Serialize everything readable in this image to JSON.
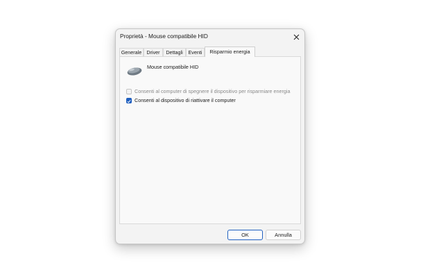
{
  "window": {
    "title": "Proprietà - Mouse compatibile HID",
    "close_icon": "close-icon"
  },
  "tabs": [
    {
      "label": "Generale",
      "active": false
    },
    {
      "label": "Driver",
      "active": false
    },
    {
      "label": "Dettagli",
      "active": false
    },
    {
      "label": "Eventi",
      "active": false
    },
    {
      "label": "Risparmio energia",
      "active": true
    }
  ],
  "device": {
    "name": "Mouse compatibile HID",
    "icon": "mouse-icon"
  },
  "options": [
    {
      "label": "Consenti al computer di spegnere il dispositivo per risparmiare energia",
      "checked": false,
      "enabled": false
    },
    {
      "label": "Consenti al dispositivo di riattivare il computer",
      "checked": true,
      "enabled": true
    }
  ],
  "buttons": {
    "ok_label": "OK",
    "cancel_label": "Annulla"
  },
  "colors": {
    "accent": "#1f5fbf",
    "dialog_bg": "#f3f3f3",
    "panel_bg": "#f9f9f9"
  }
}
